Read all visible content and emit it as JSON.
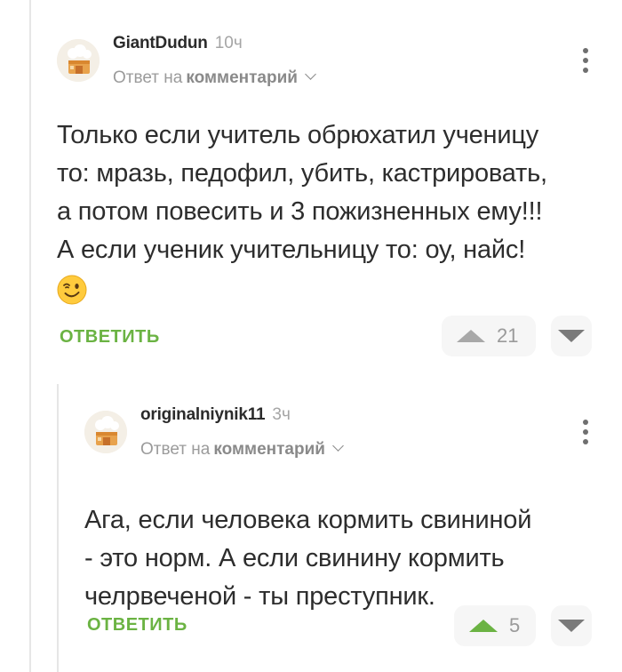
{
  "comments": [
    {
      "username": "GiantDudun",
      "time": "10ч",
      "reply_prefix": "Ответ на",
      "reply_link": "комментарий",
      "lines": [
        "Только если учитель обрюхатил ученицу",
        "то: мразь, педофил, убить, кастрировать,",
        "а потом повесить и 3 пожизненных ему!!!",
        "А если ученик учительницу то: оу, найс!"
      ],
      "emoji": "winking-face",
      "reply_label": "ОТВЕТИТЬ",
      "votes": "21",
      "upvoted": false
    },
    {
      "username": "originalniynik11",
      "time": "3ч",
      "reply_prefix": "Ответ на",
      "reply_link": "комментарий",
      "lines": [
        "Ага, если человека кормить свининой",
        "- это норм. А если свинину кормить",
        "челрвеченой - ты преступник."
      ],
      "reply_label": "ОТВЕТИТЬ",
      "votes": "5",
      "upvoted": true
    }
  ],
  "colors": {
    "accent_green": "#6bb343",
    "text": "#2d2d2d",
    "muted": "#9b9b9b",
    "vote_bg": "#f6f6f6"
  }
}
